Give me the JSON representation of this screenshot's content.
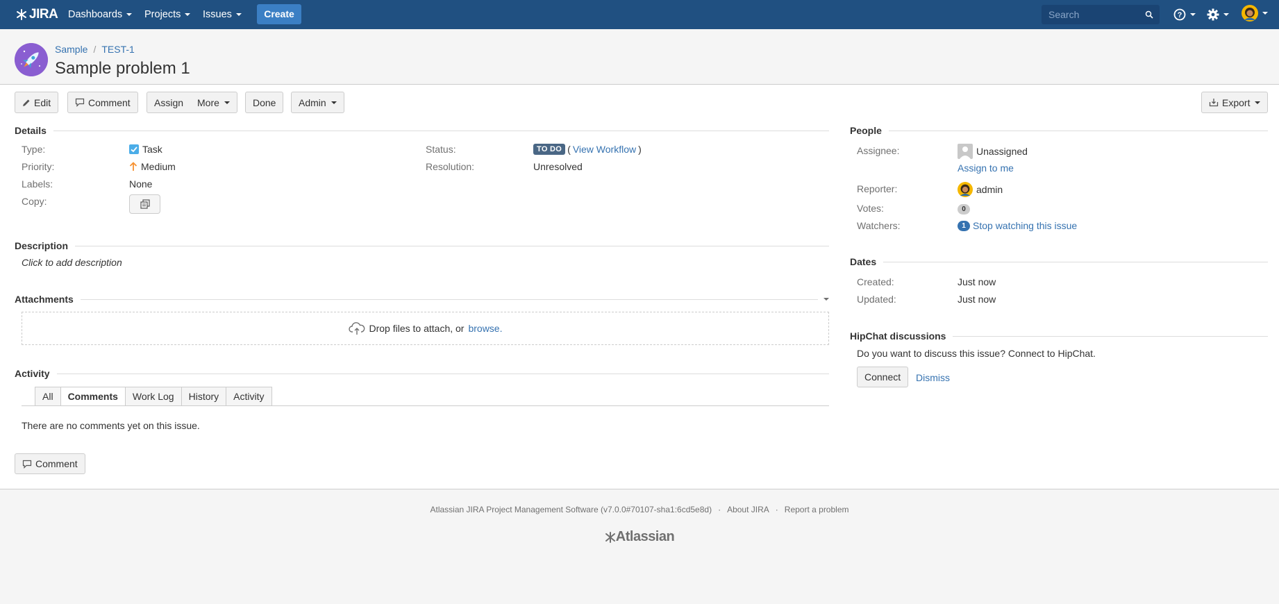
{
  "app": {
    "logo_text": "JIRA"
  },
  "nav": {
    "dashboards": "Dashboards",
    "projects": "Projects",
    "issues": "Issues",
    "create": "Create",
    "search_placeholder": "Search"
  },
  "breadcrumb": {
    "project": "Sample",
    "issue_key": "TEST-1"
  },
  "issue": {
    "title": "Sample problem 1"
  },
  "toolbar": {
    "edit": "Edit",
    "comment": "Comment",
    "assign": "Assign",
    "more": "More",
    "done": "Done",
    "admin": "Admin",
    "export": "Export"
  },
  "details": {
    "heading": "Details",
    "type_label": "Type:",
    "type_value": "Task",
    "priority_label": "Priority:",
    "priority_value": "Medium",
    "labels_label": "Labels:",
    "labels_value": "None",
    "copy_label": "Copy:",
    "status_label": "Status:",
    "status_value": "TO DO",
    "view_workflow": "View Workflow",
    "resolution_label": "Resolution:",
    "resolution_value": "Unresolved"
  },
  "description": {
    "heading": "Description",
    "placeholder": "Click to add description"
  },
  "attachments": {
    "heading": "Attachments",
    "drop_text": "Drop files to attach, or",
    "browse": "browse."
  },
  "activity": {
    "heading": "Activity",
    "tabs": [
      "All",
      "Comments",
      "Work Log",
      "History",
      "Activity"
    ],
    "active_tab": "Comments",
    "empty_text": "There are no comments yet on this issue.",
    "comment_button": "Comment"
  },
  "people": {
    "heading": "People",
    "assignee_label": "Assignee:",
    "assignee_value": "Unassigned",
    "assign_to_me": "Assign to me",
    "reporter_label": "Reporter:",
    "reporter_value": "admin",
    "votes_label": "Votes:",
    "votes_count": "0",
    "watchers_label": "Watchers:",
    "watchers_count": "1",
    "stop_watching": "Stop watching this issue"
  },
  "dates": {
    "heading": "Dates",
    "created_label": "Created:",
    "created_value": "Just now",
    "updated_label": "Updated:",
    "updated_value": "Just now"
  },
  "hipchat": {
    "heading": "HipChat discussions",
    "prompt": "Do you want to discuss this issue? Connect to HipChat.",
    "connect": "Connect",
    "dismiss": "Dismiss"
  },
  "footer": {
    "software": "Atlassian JIRA Project Management Software (v7.0.0#70107-sha1:6cd5e8d)",
    "about": "About JIRA",
    "report": "Report a problem",
    "brand": "Atlassian"
  },
  "colors": {
    "topbar": "#205081",
    "link": "#3572b0",
    "status_lozenge": "#4a6785",
    "priority_medium": "#f79232",
    "create_button": "#3b7fc4"
  }
}
